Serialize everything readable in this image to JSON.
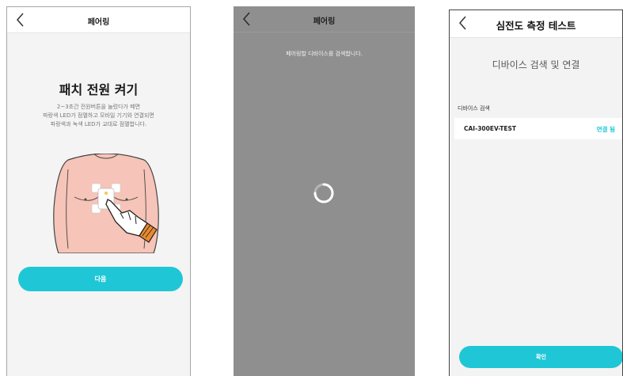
{
  "screen1": {
    "nav_title": "페어링",
    "heading": "패치 전원 켜기",
    "description": [
      "2~3초간 전원버튼을 눌렀다가 떼면",
      "파랑색 LED가 점멸하고 모바일 기기와 연결되면",
      "파랑색과 녹색 LED가 교대로 점멸합니다."
    ],
    "next_button": "다음"
  },
  "screen2": {
    "nav_title": "페어링",
    "message": "페어링할 디바이스를 검색합니다."
  },
  "screen3": {
    "nav_title": "심전도 측정 테스트",
    "heading": "디바이스 검색 및 연결",
    "section_label": "디바이스 검색",
    "devices": [
      {
        "name": "CAI-300EV-TEST",
        "status": "연결 됨"
      }
    ],
    "confirm_button": "확인"
  },
  "colors": {
    "accent": "#1fc7d6",
    "overlay_gray": "#8f8f8f",
    "skin": "#f6c4b8"
  },
  "icons": [
    "back-chevron-icon",
    "loading-spinner-icon",
    "chest-patch-illustration"
  ]
}
